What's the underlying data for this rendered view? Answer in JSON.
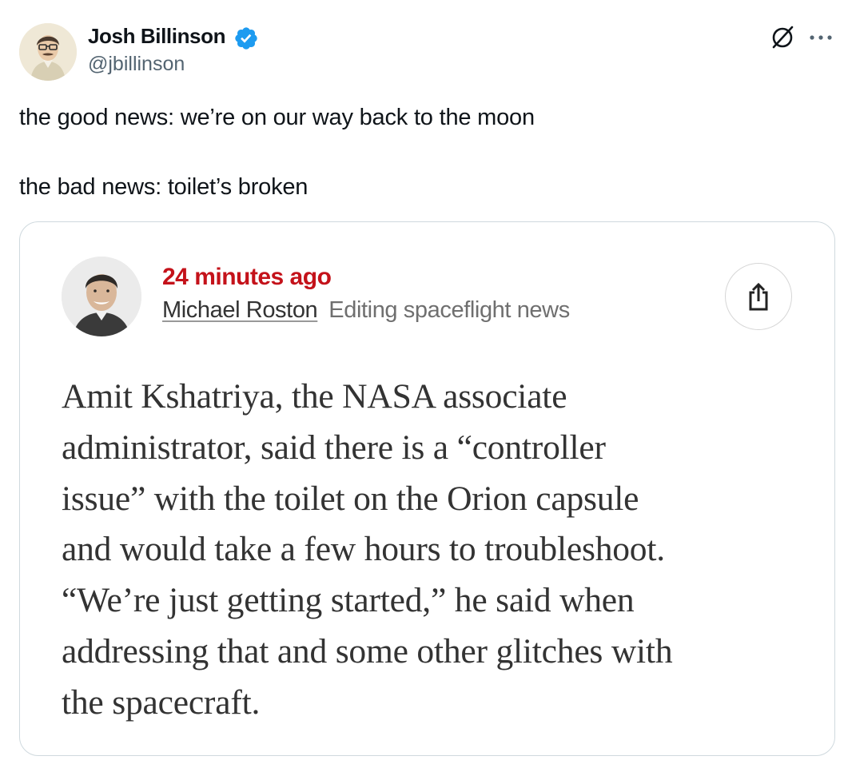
{
  "tweet": {
    "author": {
      "display_name": "Josh Billinson",
      "handle": "@jbillinson",
      "verified": true
    },
    "text_lines": [
      "the good news: we’re on our way back to the moon",
      "the bad news: toilet’s broken"
    ],
    "icons": {
      "verified": "verified-badge-icon",
      "grok": "grok-icon",
      "more": "more-options-icon"
    },
    "colors": {
      "verified": "#1d9bf0",
      "handle": "#536471"
    }
  },
  "embedded_card": {
    "timestamp": "24 minutes ago",
    "author_name": "Michael Roston",
    "author_role": "Editing spaceflight news",
    "share_icon": "share-icon",
    "body_lines": [
      "Amit Kshatriya, the NASA associate",
      "administrator, said there is a “controller",
      "issue” with the toilet on the Orion capsule",
      "and would take a few hours to troubleshoot.",
      "“We’re just getting started,” he said when",
      "addressing that and some other glitches with",
      "the spacecraft."
    ],
    "colors": {
      "timestamp": "#c4121a",
      "body_text": "#333333"
    }
  }
}
